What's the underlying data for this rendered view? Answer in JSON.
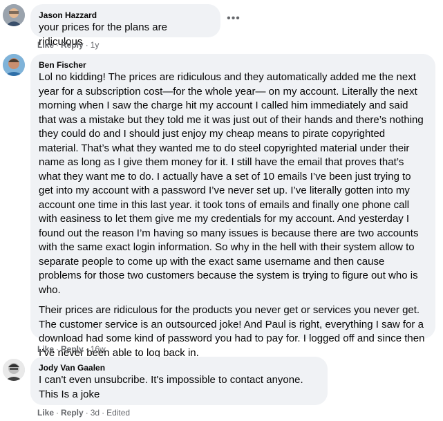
{
  "comments": [
    {
      "author": "Jason Hazzard",
      "paragraphs": [
        "your prices for the plans are ridiculous"
      ],
      "like": "Like",
      "reply": "Reply",
      "time": "1y",
      "edited": ""
    },
    {
      "author": "Ben Fischer",
      "paragraphs": [
        "Lol no kidding! The prices are ridiculous and they automatically added me the next year for a subscription cost—for the whole year— on my account. Literally the next morning when I saw the charge hit my account I called him immediately and said that was a mistake but they told me it was just out of their hands and there’s nothing they could do and I should just enjoy my cheap means to pirate copyrighted material. That’s what they wanted me to do steel copyrighted material under their name as long as I give them money for it. I still have the email that proves that’s what they want me to do. I actually have a set of 10 emails I’ve been just trying to get into my account with a password I’ve never set up. I’ve literally gotten into my account one time in this last year. it took tons of emails and finally one phone call with easiness to let them give me my credentials for my account. And yesterday I found out the reason I’m having so many issues is because there are two accounts with the same exact login information. So why in the hell with their system allow to separate people to come up with the exact same username and then cause problems for those two customers because the system is trying to figure out who is who.",
        "Their prices are ridiculous for the products you never get or services you never get. The customer service is an outsourced joke! And Paul is right, everything I saw for a download had some kind of password you had to pay for. I logged off and since then I’ve never been able to log back in."
      ],
      "like": "Like",
      "reply": "Reply",
      "time": "16w",
      "edited": ""
    },
    {
      "author": "Jody Van Gaalen",
      "paragraphs": [
        "I can't even unsubcribe. It's impossible to contact anyone. This Is a joke"
      ],
      "like": "Like",
      "reply": "Reply",
      "time": "3d",
      "edited": "Edited"
    }
  ],
  "more_icon": "more-horizontal-icon"
}
